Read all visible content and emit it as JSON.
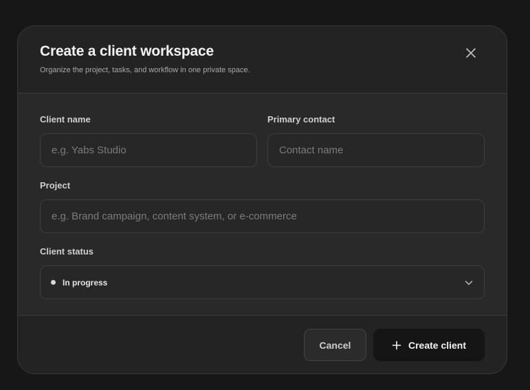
{
  "modal": {
    "title": "Create a client workspace",
    "subtitle": "Organize the project, tasks, and workflow in one private space.",
    "close_icon": "close-icon"
  },
  "form": {
    "client_name": {
      "label": "Client name",
      "placeholder": "e.g. Yabs Studio",
      "value": ""
    },
    "primary_contact": {
      "label": "Primary contact",
      "placeholder": "Contact name",
      "value": ""
    },
    "project": {
      "label": "Project",
      "placeholder": "e.g. Brand campaign, content system, or e-commerce",
      "value": ""
    },
    "client_status": {
      "label": "Client status",
      "selected": "In progress",
      "dot_color": "#d6d6d6",
      "icon": "chevron-down-icon"
    }
  },
  "footer": {
    "cancel_label": "Cancel",
    "create_label": "Create client",
    "create_icon": "plus-icon"
  },
  "colors": {
    "background": "#171717",
    "modal_body": "#292929",
    "modal_header": "#232323",
    "primary_button": "#151515"
  }
}
